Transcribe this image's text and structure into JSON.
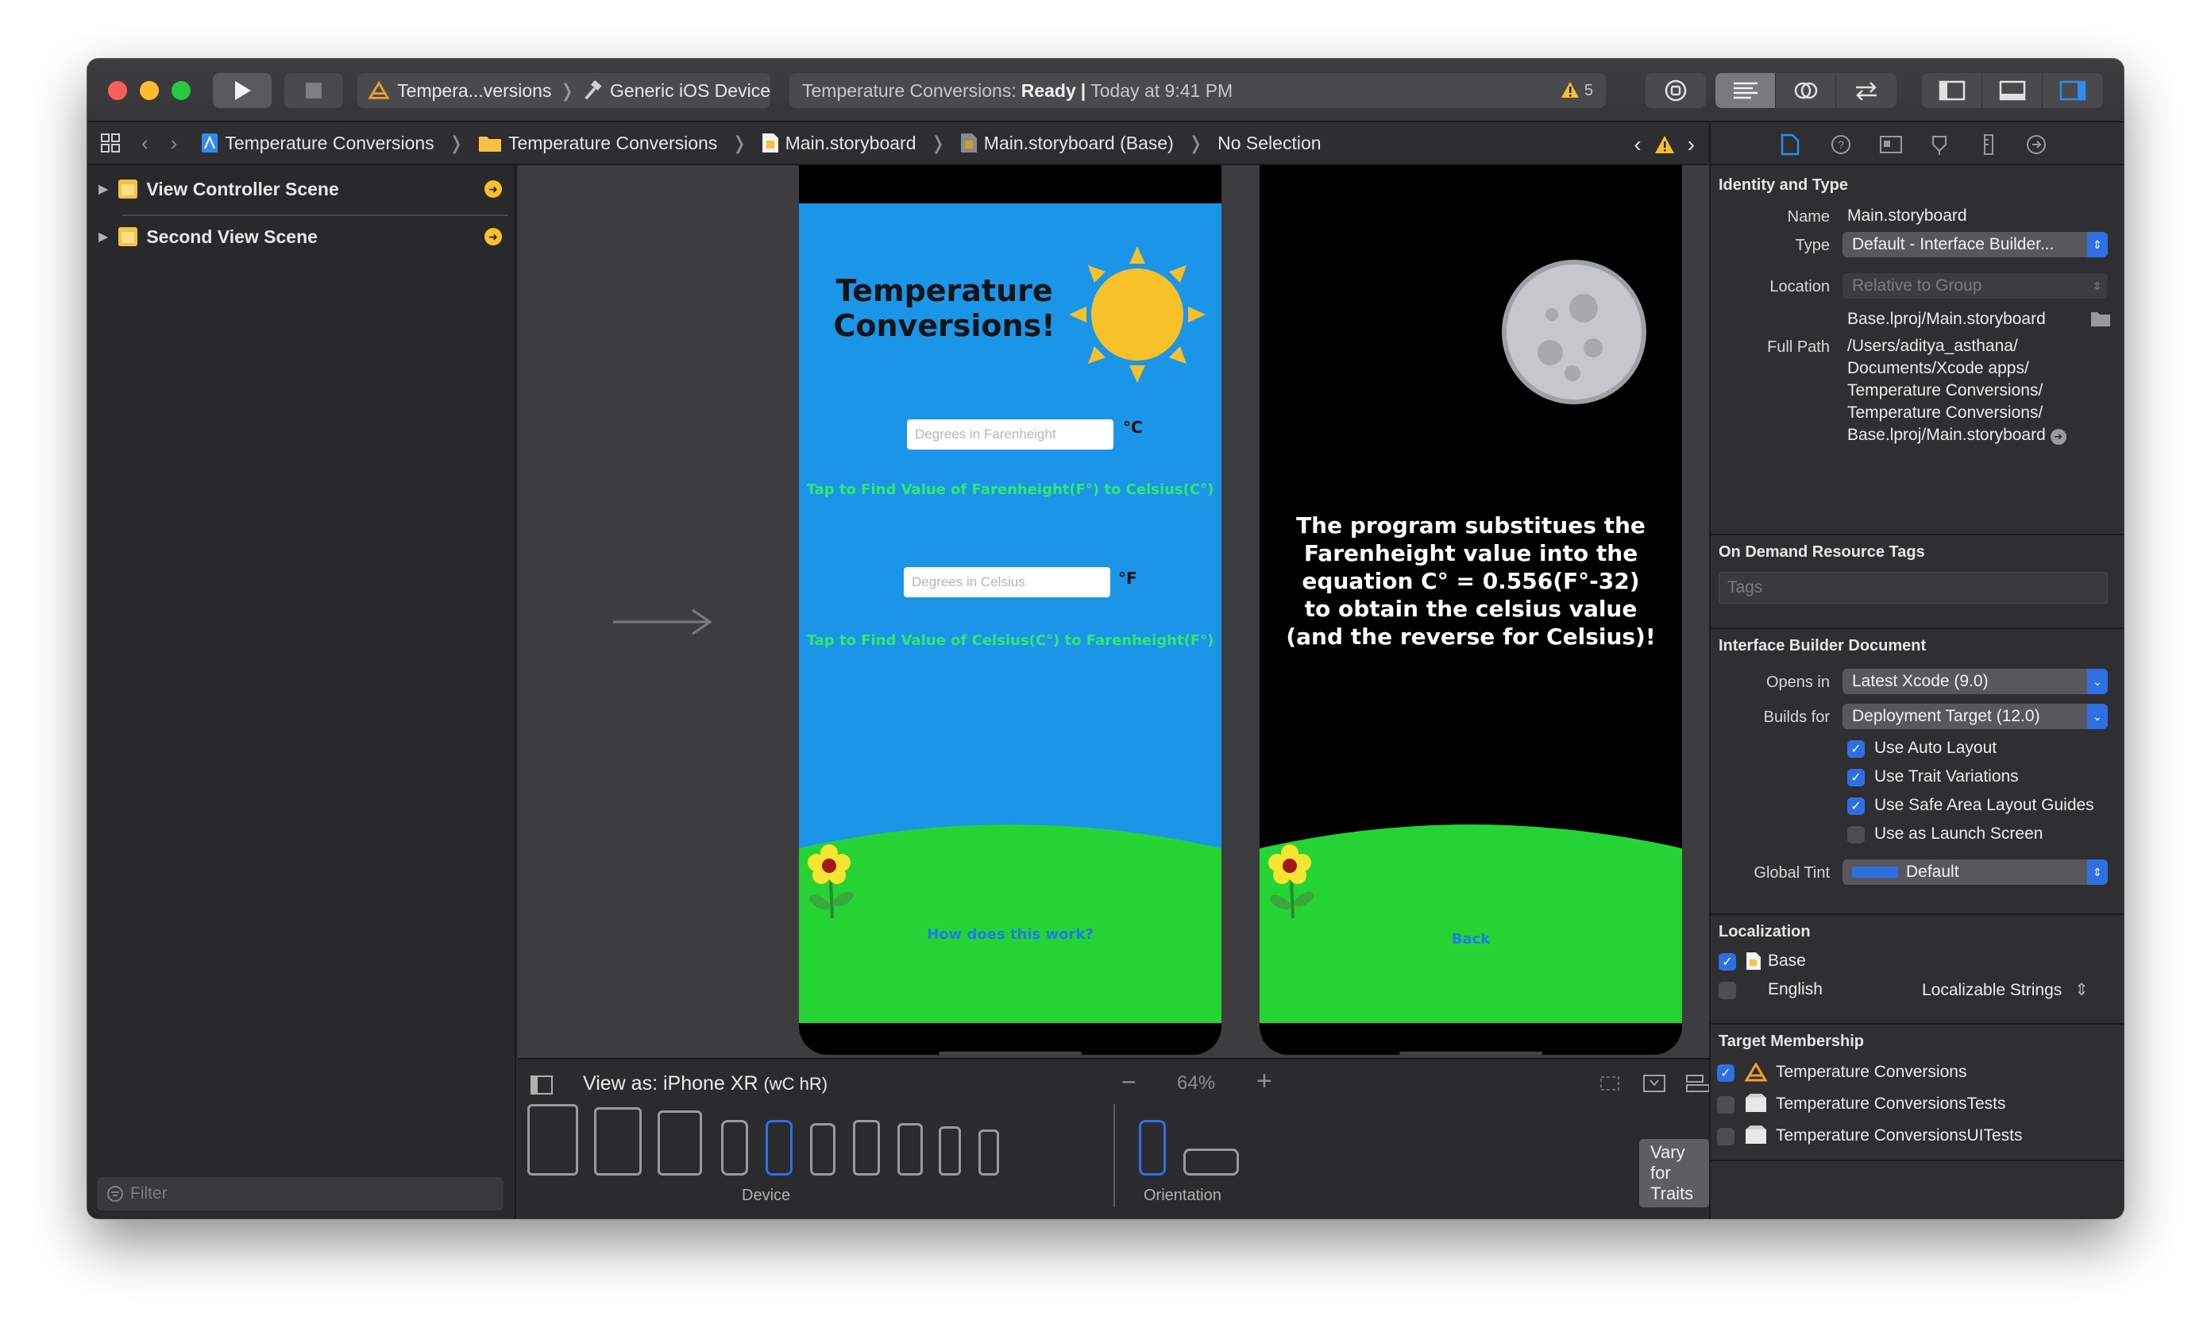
{
  "toolbar": {
    "scheme_name": "Tempera...versions",
    "device_name": "Generic iOS Device",
    "status_app": "Temperature Conversions:",
    "status_state": "Ready",
    "status_sep": "|",
    "status_time": "Today at 9:41 PM",
    "warning_count": "5"
  },
  "jumpbar": {
    "crumbs": [
      "Temperature Conversions",
      "Temperature Conversions",
      "Main.storyboard",
      "Main.storyboard (Base)",
      "No Selection"
    ]
  },
  "outline": {
    "scenes": [
      "View Controller Scene",
      "Second View Scene"
    ],
    "filter_placeholder": "Filter"
  },
  "scene1": {
    "title_line1": "Temperature",
    "title_line2": "Conversions!",
    "field1_placeholder": "Degrees in Farenheight",
    "unit1": "°C",
    "button1": "Tap to Find Value of Farenheight(F°) to Celsius(C°)",
    "field2_placeholder": "Degrees in Celsius",
    "unit2": "°F",
    "button2": "Tap to Find Value of Celsius(C°) to Farenheight(F°)",
    "how_button": "How does this work?"
  },
  "scene2": {
    "explanation_lines": [
      "The program substitues the",
      "Farenheight value into the",
      "equation C° = 0.556(F°-32)",
      "to obtain the celsius value",
      "(and the reverse for Celsius)!"
    ],
    "back_button": "Back"
  },
  "bottom": {
    "view_as_prefix": "View as: ",
    "view_as_device": "iPhone XR",
    "view_as_traits": "(wC hR)",
    "zoom": "64%",
    "device_label": "Device",
    "orientation_label": "Orientation",
    "vary_button": "Vary for Traits"
  },
  "inspector": {
    "identity_title": "Identity and Type",
    "name_label": "Name",
    "name_value": "Main.storyboard",
    "type_label": "Type",
    "type_value": "Default - Interface Builder...",
    "location_label": "Location",
    "location_value": "Relative to Group",
    "location_file": "Base.lproj/Main.storyboard",
    "fullpath_label": "Full Path",
    "fullpath_lines": [
      "/Users/aditya_asthana/",
      "Documents/Xcode apps/",
      "Temperature Conversions/",
      "Temperature Conversions/",
      "Base.lproj/Main.storyboard"
    ],
    "odr_title": "On Demand Resource Tags",
    "tags_placeholder": "Tags",
    "ibdoc_title": "Interface Builder Document",
    "opens_label": "Opens in",
    "opens_value": "Latest Xcode (9.0)",
    "builds_label": "Builds for",
    "builds_value": "Deployment Target (12.0)",
    "options": [
      {
        "label": "Use Auto Layout",
        "checked": true
      },
      {
        "label": "Use Trait Variations",
        "checked": true
      },
      {
        "label": "Use Safe Area Layout Guides",
        "checked": true
      },
      {
        "label": "Use as Launch Screen",
        "checked": false
      }
    ],
    "tint_label": "Global Tint",
    "tint_value": "Default",
    "tint_color": "#2f6fe4",
    "localization_title": "Localization",
    "loc_base": "Base",
    "loc_english": "English",
    "loc_english_value": "Localizable Strings",
    "membership_title": "Target Membership",
    "targets": [
      "Temperature Conversions",
      "Temperature ConversionsTests",
      "Temperature ConversionsUITests"
    ]
  },
  "colors": {
    "sky": "#1b95e8",
    "grass": "#25d434",
    "sun": "#f7c12a",
    "button_text": "#34e86a",
    "accent": "#2f6fe4"
  }
}
